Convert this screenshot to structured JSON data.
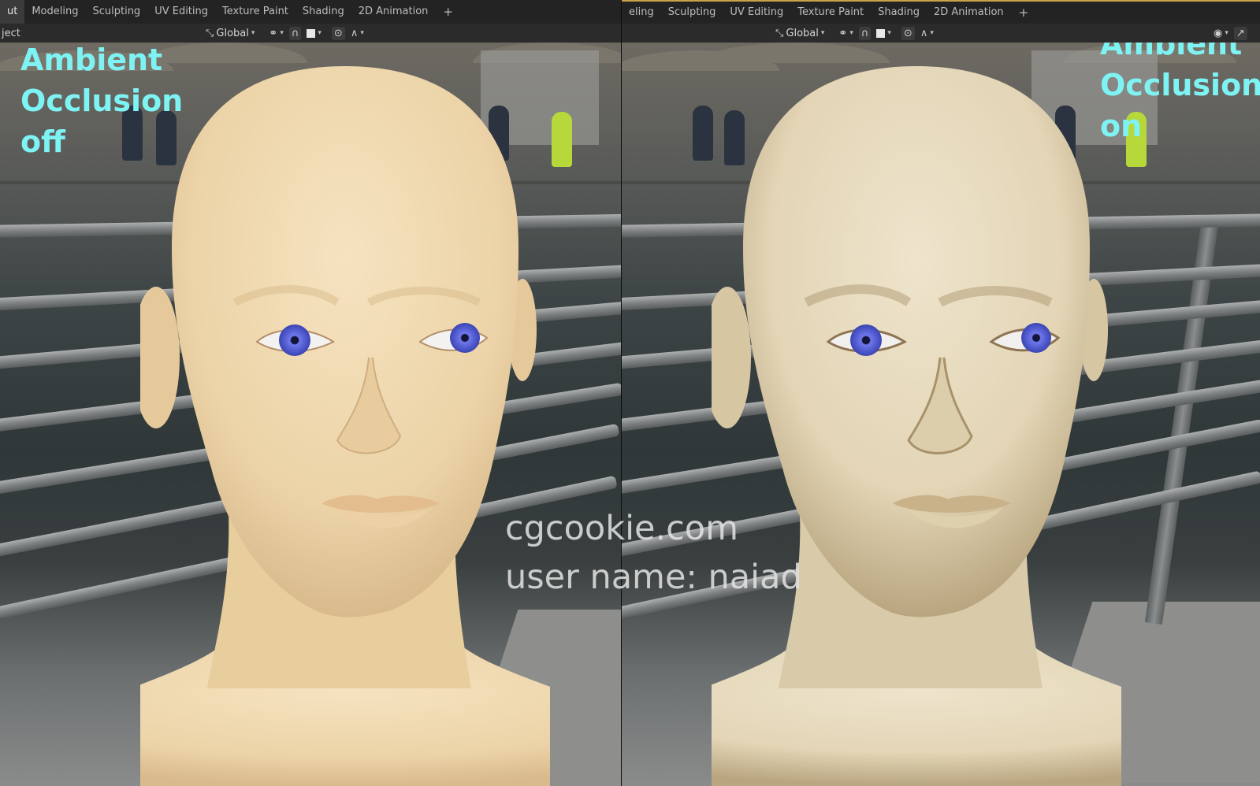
{
  "left_header": {
    "tabs": [
      {
        "label": "ut",
        "active": true
      },
      {
        "label": "Modeling",
        "active": false
      },
      {
        "label": "Sculpting",
        "active": false
      },
      {
        "label": "UV Editing",
        "active": false
      },
      {
        "label": "Texture Paint",
        "active": false
      },
      {
        "label": "Shading",
        "active": false
      },
      {
        "label": "2D Animation",
        "active": false
      }
    ],
    "add_tab": "+"
  },
  "right_header": {
    "tabs": [
      {
        "label": "eling",
        "active": false
      },
      {
        "label": "Sculpting",
        "active": false
      },
      {
        "label": "UV Editing",
        "active": false
      },
      {
        "label": "Texture Paint",
        "active": false
      },
      {
        "label": "Shading",
        "active": false
      },
      {
        "label": "2D Animation",
        "active": false
      }
    ],
    "add_tab": "+"
  },
  "left_toolbar": {
    "mode_text": "ject",
    "orientation": "Global"
  },
  "right_toolbar": {
    "orientation": "Global"
  },
  "labels": {
    "left": [
      "Ambient",
      "Occlusion",
      "off"
    ],
    "right": [
      "Ambient",
      "Occlusion",
      "on"
    ]
  },
  "watermark": {
    "line1": "cgcookie.com",
    "line2": "user name: naiad"
  },
  "icons": {
    "transform": "transform-orientation-icon",
    "pivot": "pivot-point-icon",
    "snap": "snap-magnet-icon",
    "snap_target": "snap-target-icon",
    "proportional": "proportional-editing-icon",
    "falloff": "falloff-curve-icon",
    "visibility": "eye-icon",
    "gizmo": "gizmo-icon"
  },
  "colors": {
    "label_accent": "#7ef3f3",
    "skin_off": "#efd9b3",
    "skin_on": "#e6dbc3",
    "iris": "#5a64d8",
    "active_workspace_bar": "#c9a24a"
  }
}
